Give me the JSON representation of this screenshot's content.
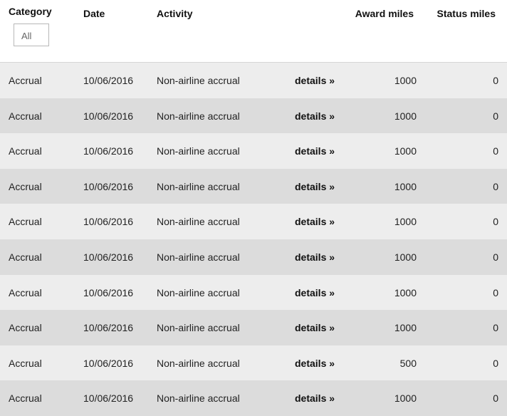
{
  "header": {
    "category": "Category",
    "date": "Date",
    "activity": "Activity",
    "award_miles": "Award miles",
    "status_miles": "Status miles",
    "category_filter": "All"
  },
  "details_label": "details »",
  "rows": [
    {
      "category": "Accrual",
      "date": "10/06/2016",
      "activity": "Non-airline accrual",
      "award_miles": "1000",
      "status_miles": "0"
    },
    {
      "category": "Accrual",
      "date": "10/06/2016",
      "activity": "Non-airline accrual",
      "award_miles": "1000",
      "status_miles": "0"
    },
    {
      "category": "Accrual",
      "date": "10/06/2016",
      "activity": "Non-airline accrual",
      "award_miles": "1000",
      "status_miles": "0"
    },
    {
      "category": "Accrual",
      "date": "10/06/2016",
      "activity": "Non-airline accrual",
      "award_miles": "1000",
      "status_miles": "0"
    },
    {
      "category": "Accrual",
      "date": "10/06/2016",
      "activity": "Non-airline accrual",
      "award_miles": "1000",
      "status_miles": "0"
    },
    {
      "category": "Accrual",
      "date": "10/06/2016",
      "activity": "Non-airline accrual",
      "award_miles": "1000",
      "status_miles": "0"
    },
    {
      "category": "Accrual",
      "date": "10/06/2016",
      "activity": "Non-airline accrual",
      "award_miles": "1000",
      "status_miles": "0"
    },
    {
      "category": "Accrual",
      "date": "10/06/2016",
      "activity": "Non-airline accrual",
      "award_miles": "1000",
      "status_miles": "0"
    },
    {
      "category": "Accrual",
      "date": "10/06/2016",
      "activity": "Non-airline accrual",
      "award_miles": "500",
      "status_miles": "0"
    },
    {
      "category": "Accrual",
      "date": "10/06/2016",
      "activity": "Non-airline accrual",
      "award_miles": "1000",
      "status_miles": "0"
    }
  ]
}
